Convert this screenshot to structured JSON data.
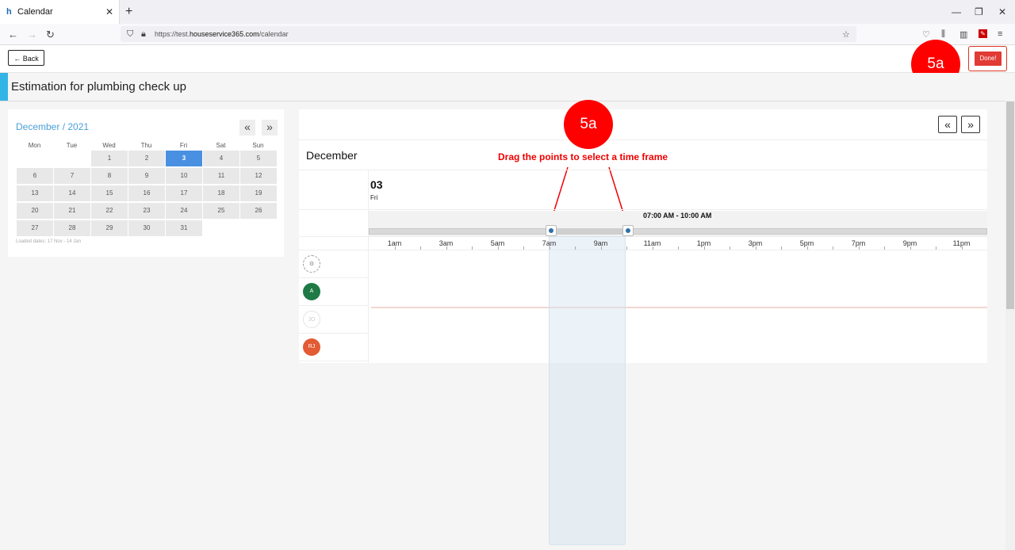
{
  "browser": {
    "tab_title": "Calendar",
    "favicon": "h",
    "url_prefix": "https://test.",
    "url_domain": "houseservice365.com",
    "url_path": "/calendar"
  },
  "header": {
    "back_label": "Back",
    "done_label": "Done!"
  },
  "page_title": "Estimation for plumbing check up",
  "markers": {
    "top": "5a",
    "mid": "5a"
  },
  "annotation": "Drag the points to select a time frame",
  "mini_calendar": {
    "title": "December / 2021",
    "weekdays": [
      "Mon",
      "Tue",
      "Wed",
      "Thu",
      "Fri",
      "Sat",
      "Sun"
    ],
    "weeks": [
      [
        "",
        "",
        "1",
        "2",
        "3",
        "4",
        "5"
      ],
      [
        "6",
        "7",
        "8",
        "9",
        "10",
        "11",
        "12"
      ],
      [
        "13",
        "14",
        "15",
        "16",
        "17",
        "18",
        "19"
      ],
      [
        "20",
        "21",
        "22",
        "23",
        "24",
        "25",
        "26"
      ],
      [
        "27",
        "28",
        "29",
        "30",
        "31",
        "",
        ""
      ]
    ],
    "selected_day": "3",
    "loaded_dates": "Loaded dates: 17 Nov - 14 Jan"
  },
  "scheduler": {
    "month": "December",
    "day_number": "03",
    "day_name": "Fri",
    "range_label": "07:00 AM - 10:00 AM",
    "hour_labels": [
      "1am",
      "3am",
      "5am",
      "7am",
      "9am",
      "11am",
      "1pm",
      "3pm",
      "5pm",
      "7pm",
      "9pm",
      "11pm"
    ],
    "selection_start_hour": 7,
    "selection_end_hour": 10,
    "resources": [
      {
        "initials": "",
        "kind": "unassigned",
        "color": "#ffffff"
      },
      {
        "initials": "A",
        "kind": "staff",
        "color": "#1e7a45"
      },
      {
        "initials": "JO",
        "kind": "staff-faded",
        "color": "#ffffff"
      },
      {
        "initials": "RJ",
        "kind": "staff",
        "color": "#e25b34"
      }
    ]
  },
  "colors": {
    "accent": "#33b4e6",
    "done": "#e23a34",
    "selected_day": "#4a90e2",
    "marker": "#ff0000"
  }
}
